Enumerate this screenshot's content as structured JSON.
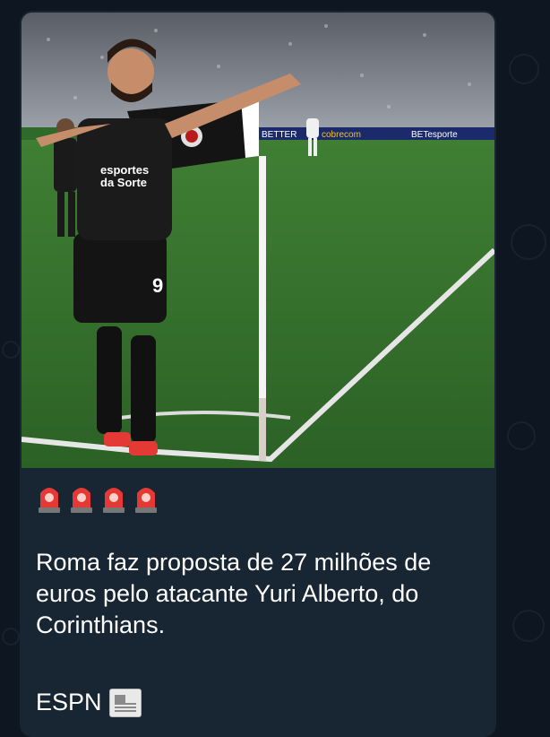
{
  "message": {
    "image_alt": "Jogador do Corinthians comemorando com a bandeira de escanteio",
    "reaction_emojis": [
      "siren",
      "siren",
      "siren",
      "siren"
    ],
    "caption": "Roma faz proposta de 27 milhões de euros pelo atacante Yuri Alberto, do Corinthians.",
    "source": "ESPN",
    "source_icon": "newspaper-icon"
  },
  "photo_text": {
    "sponsor_line1": "esportes",
    "sponsor_line2": "da Sorte",
    "shirt_number": "9",
    "board_1": "BETTER",
    "board_2": "cobrecom",
    "board_3": "BETesporte"
  },
  "colors": {
    "background": "#0e1621",
    "bubble": "#182533",
    "text": "#ffffff",
    "siren_red": "#e53935"
  }
}
